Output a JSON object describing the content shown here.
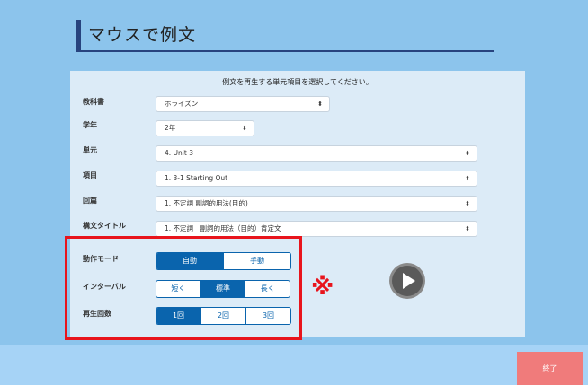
{
  "page": {
    "title": "マウスで例文"
  },
  "panel": {
    "header": "例文を再生する単元項目を選択してください。",
    "rows": [
      {
        "label": "教科書",
        "value": "ホライズン"
      },
      {
        "label": "学年",
        "value": "2年"
      },
      {
        "label": "単元",
        "value": "4. Unit 3"
      },
      {
        "label": "項目",
        "value": "1. 3-1 Starting Out"
      },
      {
        "label": "回篇",
        "value": "1. 不定詞 副詞的用法(目的)"
      },
      {
        "label": "構文タイトル",
        "value": "1. 不定詞　副詞的用法（目的）肯定文"
      }
    ]
  },
  "controls": {
    "mode": {
      "label": "動作モード",
      "options": [
        "自動",
        "手動"
      ],
      "selected": "自動"
    },
    "interval": {
      "label": "インターバル",
      "options": [
        "短く",
        "標準",
        "長く"
      ],
      "selected": "標準"
    },
    "repeat": {
      "label": "再生回数",
      "options": [
        "1回",
        "2回",
        "3回"
      ],
      "selected": "1回"
    }
  },
  "note_mark": "※",
  "footer": {
    "end_label": "終了"
  },
  "icons": {
    "play": "play-circle-icon",
    "dropdown": "up-down-arrow-icon"
  },
  "colors": {
    "background": "#8cc4ec",
    "accent": "#0a64ad",
    "highlight": "#e8141c",
    "end_button": "#f07b7b"
  }
}
